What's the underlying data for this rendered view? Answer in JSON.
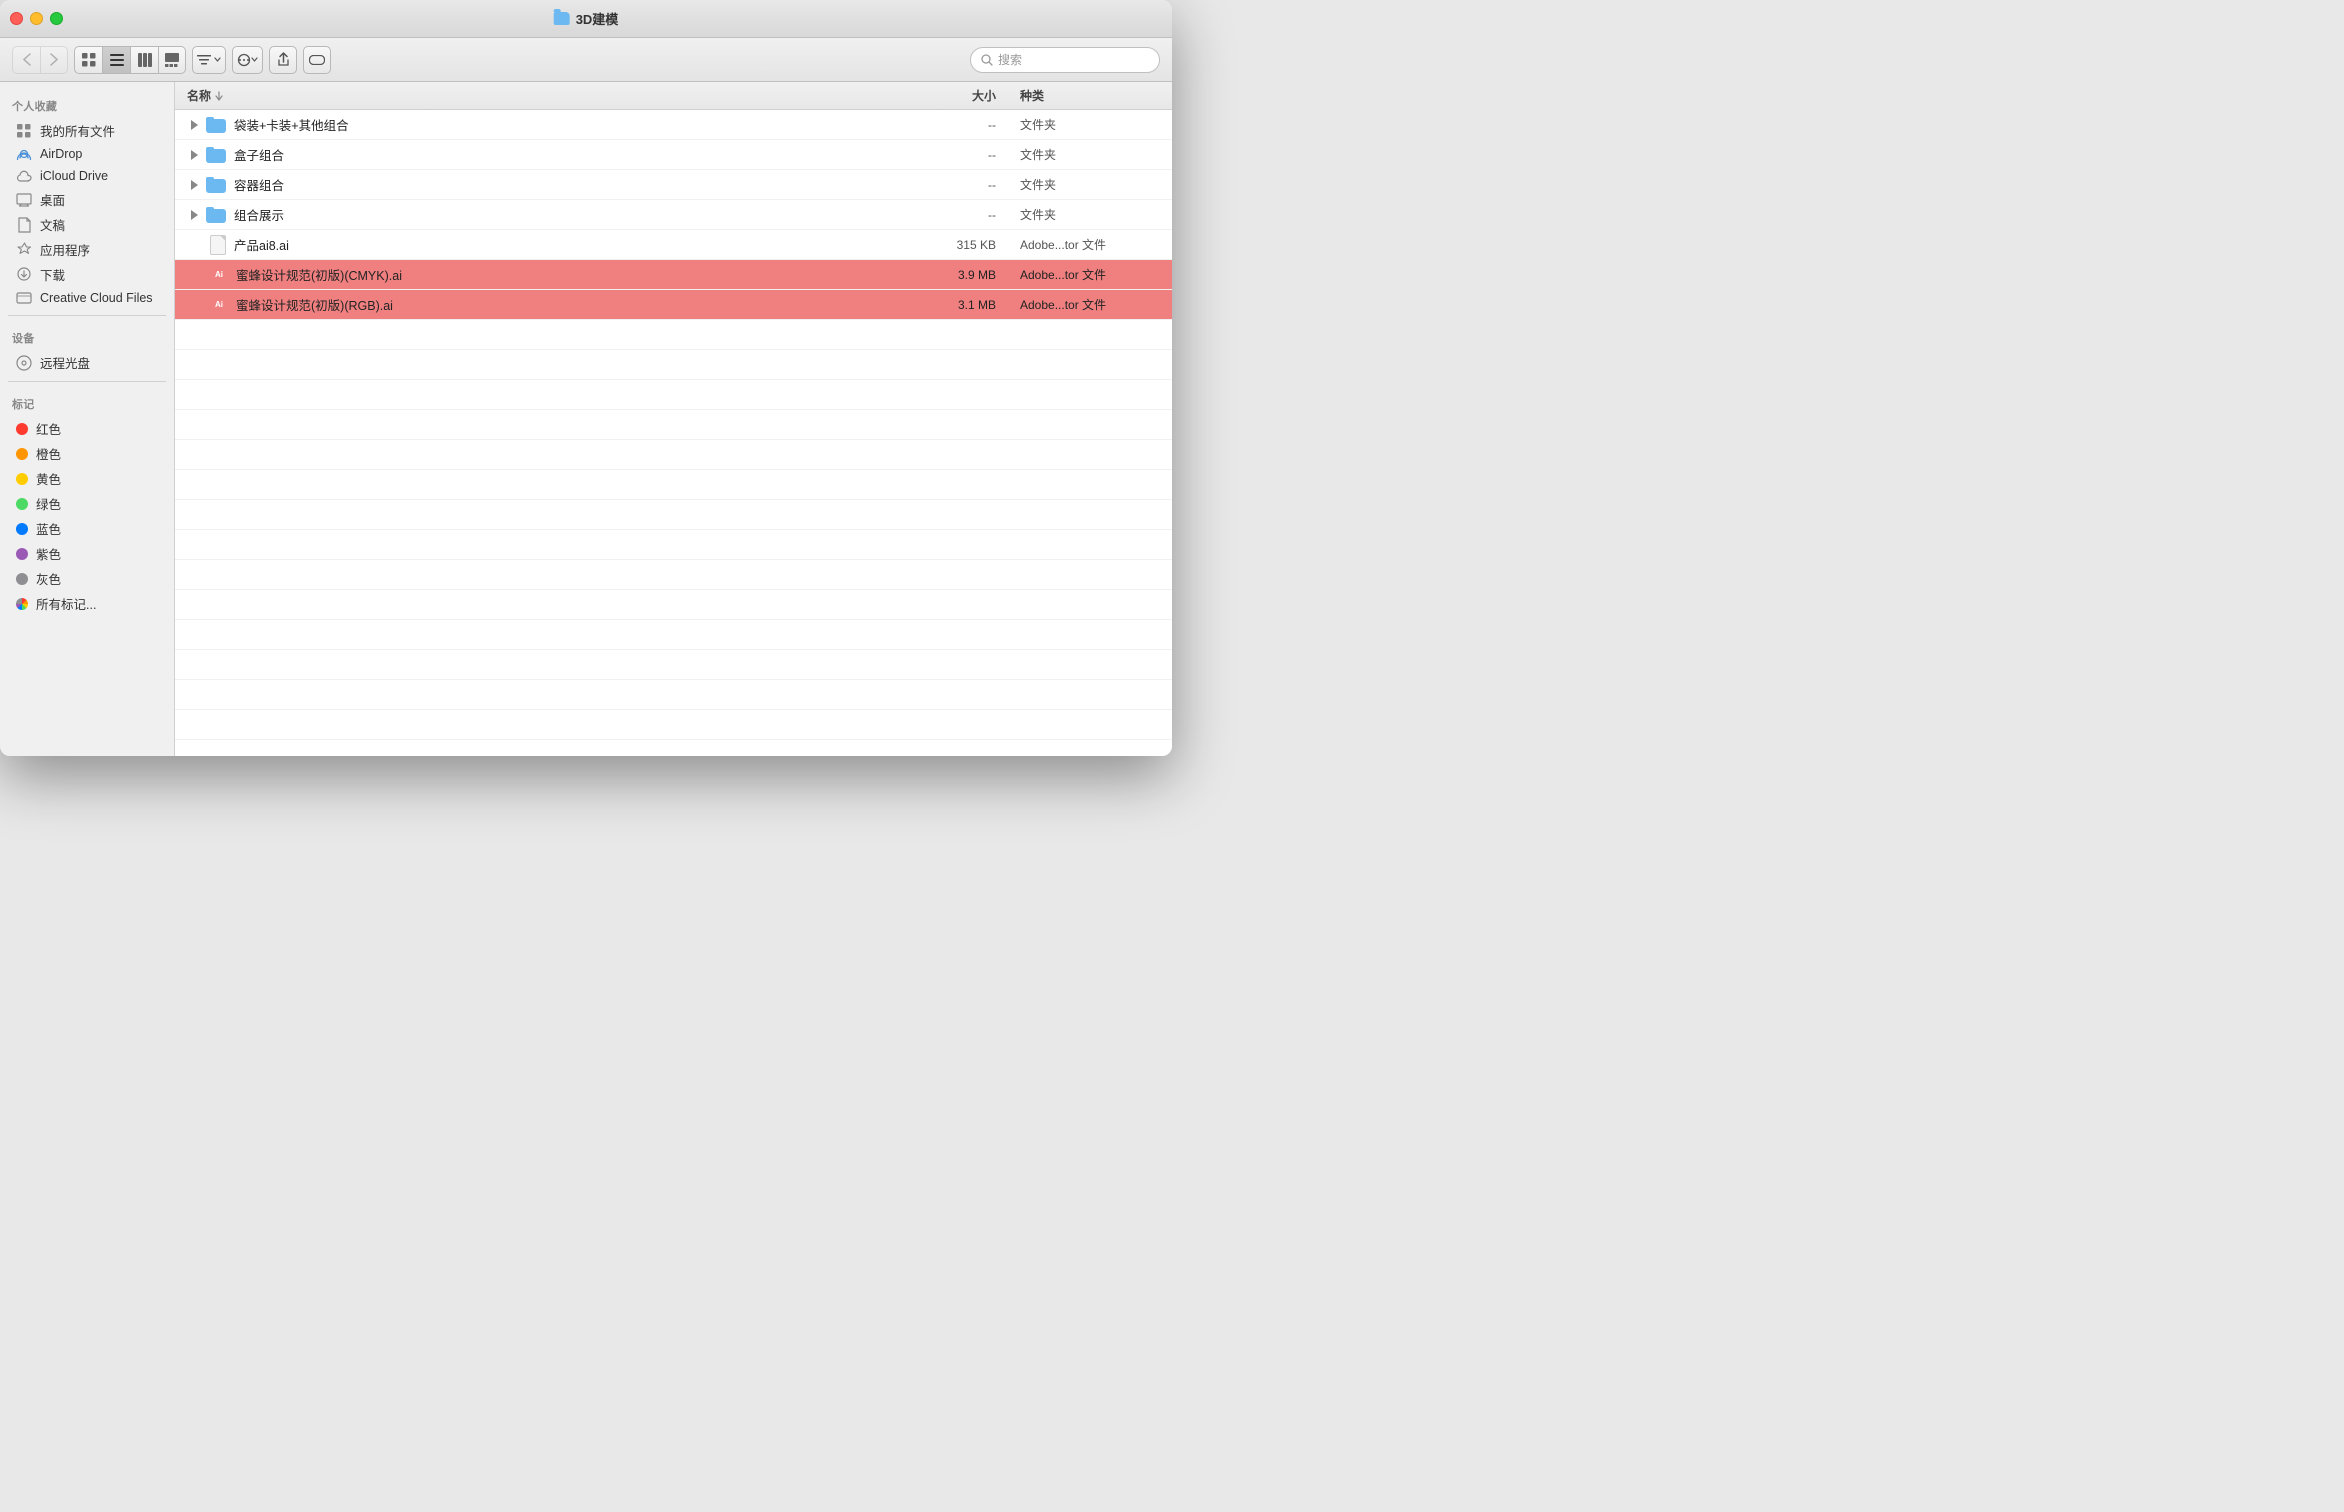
{
  "window": {
    "title": "3D建模",
    "traffic_lights": [
      "close",
      "minimize",
      "maximize"
    ]
  },
  "toolbar": {
    "back_label": "‹",
    "forward_label": "›",
    "view_icon_label": "⊞",
    "view_list_label": "≡",
    "view_column_label": "⊟",
    "view_gallery_label": "⊠",
    "sort_label": "⊟▾",
    "action_label": "↑",
    "share_label": "⤴",
    "path_label": "—",
    "search_placeholder": "搜索"
  },
  "sidebar": {
    "personal_section": "个人收藏",
    "devices_section": "设备",
    "tags_section": "标记",
    "items": [
      {
        "id": "all-files",
        "label": "我的所有文件",
        "icon": "grid"
      },
      {
        "id": "airdrop",
        "label": "AirDrop",
        "icon": "airdrop"
      },
      {
        "id": "icloud",
        "label": "iCloud Drive",
        "icon": "cloud"
      },
      {
        "id": "desktop",
        "label": "桌面",
        "icon": "desktop"
      },
      {
        "id": "documents",
        "label": "文稿",
        "icon": "doc"
      },
      {
        "id": "apps",
        "label": "应用程序",
        "icon": "apps"
      },
      {
        "id": "downloads",
        "label": "下载",
        "icon": "download"
      },
      {
        "id": "creative-cloud",
        "label": "Creative Cloud Files",
        "icon": "cc"
      }
    ],
    "device_items": [
      {
        "id": "dvd",
        "label": "远程光盘",
        "icon": "dvd"
      }
    ],
    "tag_items": [
      {
        "id": "red",
        "label": "红色",
        "color": "#ff3b30"
      },
      {
        "id": "orange",
        "label": "橙色",
        "color": "#ff9500"
      },
      {
        "id": "yellow",
        "label": "黄色",
        "color": "#ffcc00"
      },
      {
        "id": "green",
        "label": "绿色",
        "color": "#4cd964"
      },
      {
        "id": "blue",
        "label": "蓝色",
        "color": "#007aff"
      },
      {
        "id": "purple",
        "label": "紫色",
        "color": "#9b59b6"
      },
      {
        "id": "gray",
        "label": "灰色",
        "color": "#8e8e93"
      },
      {
        "id": "all-tags",
        "label": "所有标记...",
        "color": null
      }
    ]
  },
  "file_list": {
    "columns": {
      "name": "名称",
      "size": "大小",
      "kind": "种类"
    },
    "rows": [
      {
        "id": "row1",
        "name": "袋装+卡装+其他组合",
        "type": "folder",
        "size": "--",
        "kind": "文件夹",
        "selected": false
      },
      {
        "id": "row2",
        "name": "盒子组合",
        "type": "folder",
        "size": "--",
        "kind": "文件夹",
        "selected": false
      },
      {
        "id": "row3",
        "name": "容器组合",
        "type": "folder",
        "size": "--",
        "kind": "文件夹",
        "selected": false
      },
      {
        "id": "row4",
        "name": "组合展示",
        "type": "folder",
        "size": "--",
        "kind": "文件夹",
        "selected": false
      },
      {
        "id": "row5",
        "name": "产品ai8.ai",
        "type": "doc",
        "size": "315 KB",
        "kind": "Adobe...tor 文件",
        "selected": false
      },
      {
        "id": "row6",
        "name": "蜜蜂设计规范(初版)(CMYK).ai",
        "type": "ai",
        "size": "3.9 MB",
        "kind": "Adobe...tor 文件",
        "selected": true
      },
      {
        "id": "row7",
        "name": "蜜蜂设计规范(初版)(RGB).ai",
        "type": "ai",
        "size": "3.1 MB",
        "kind": "Adobe...tor 文件",
        "selected": true
      }
    ]
  }
}
